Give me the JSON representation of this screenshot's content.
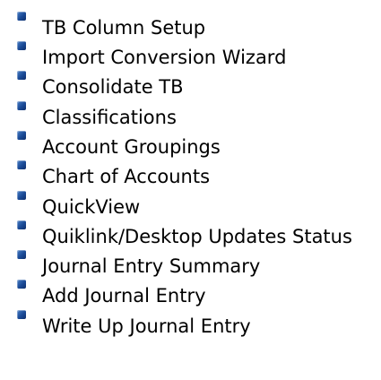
{
  "menu": {
    "bullet_color": "#1a4a96",
    "items": [
      {
        "label": "TB Column Setup"
      },
      {
        "label": "Import Conversion Wizard"
      },
      {
        "label": "Consolidate TB"
      },
      {
        "label": "Classifications"
      },
      {
        "label": "Account Groupings"
      },
      {
        "label": "Chart of Accounts"
      },
      {
        "label": "QuickView"
      },
      {
        "label": "Quiklink/Desktop Updates Status"
      },
      {
        "label": "Journal Entry Summary"
      },
      {
        "label": "Add Journal Entry"
      },
      {
        "label": "Write Up Journal Entry"
      }
    ]
  }
}
